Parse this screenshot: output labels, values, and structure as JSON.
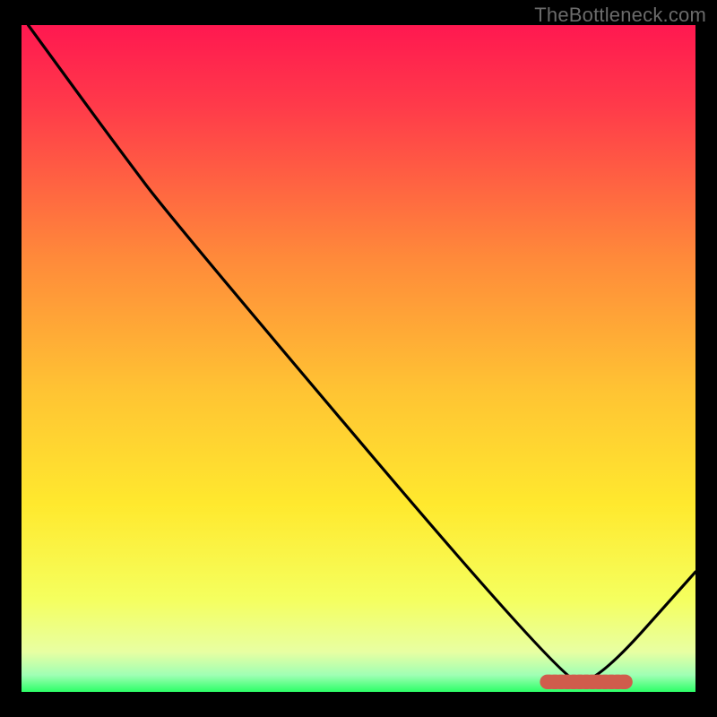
{
  "watermark": "TheBottleneck.com",
  "colors": {
    "black": "#000000",
    "curve": "#000000",
    "marker": "#d05c4c",
    "grad_top": "#ff1850",
    "grad_mid": "#ffdc2e",
    "grad_low": "#f6ff7a",
    "grad_green": "#2cff67"
  },
  "chart_data": {
    "type": "line",
    "title": "",
    "xlabel": "",
    "ylabel": "",
    "xlim": [
      0,
      100
    ],
    "ylim": [
      0,
      100
    ],
    "curve_points": [
      {
        "x": 1,
        "y": 100
      },
      {
        "x": 14,
        "y": 82
      },
      {
        "x": 23,
        "y": 70
      },
      {
        "x": 80,
        "y": 2
      },
      {
        "x": 85,
        "y": 1
      },
      {
        "x": 100,
        "y": 18
      }
    ],
    "marker_segment": {
      "x_start": 78,
      "x_end": 90,
      "y": 1.5,
      "thickness": 2.2
    }
  }
}
